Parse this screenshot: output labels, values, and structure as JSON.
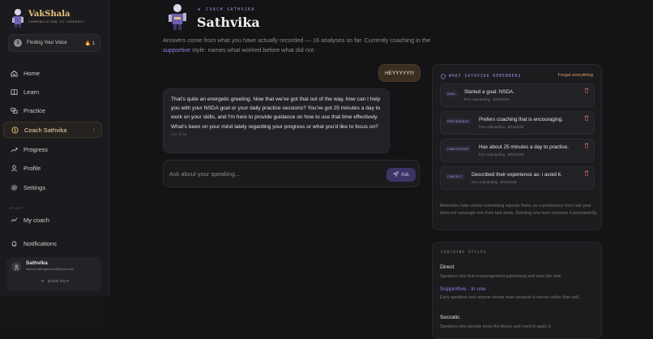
{
  "brand": {
    "name": "VakShala",
    "tagline": "COMMUNICATION IS CURRENCY"
  },
  "level": {
    "badge": "1",
    "label": "Finding Your Voice",
    "streak": "🔥 1"
  },
  "nav": [
    {
      "label": "Home",
      "icon": "home-icon"
    },
    {
      "label": "Learn",
      "icon": "book-icon"
    },
    {
      "label": "Practice",
      "icon": "practice-icon"
    },
    {
      "label": "Coach Sathvika",
      "icon": "coach-icon",
      "active": true
    },
    {
      "label": "Progress",
      "icon": "trend-icon"
    },
    {
      "label": "Profile",
      "icon": "user-icon"
    },
    {
      "label": "Settings",
      "icon": "gear-icon"
    }
  ],
  "staff": {
    "heading": "STAFF",
    "items": [
      {
        "label": "My coach",
        "icon": "coach-link-icon"
      }
    ]
  },
  "notifications": {
    "label": "Notifications"
  },
  "user": {
    "name": "Sathvika",
    "email": "learnachallengemyself@gmail.com",
    "signout": "SIGN OUT"
  },
  "coach": {
    "tag": "COACH SATHVIKA",
    "name": "Sathvika",
    "intro_pre": "Answers come from what you have actually recorded — 16 analyses so far. Currently coaching in the ",
    "intro_style": "supportive",
    "intro_post": " style: names what worked before what did not."
  },
  "chat": {
    "user_message": "HEYYYYY!!!",
    "coach_message": "That's quite an energetic greeting. Now that we've got that out of the way, how can I help you with your NSDA goal or your daily practice sessions? You've got 25 minutes a day to work on your skills, and I'm here to provide guidance on how to use that time effectively. What's been on your mind lately regarding your progress or what you'd like to focus on?",
    "via": "via Groq",
    "input_placeholder": "Ask about your speaking...",
    "ask_label": "Ask"
  },
  "memory": {
    "title": "WHAT SATHVIKA REMEMBERS",
    "forget": "Forget everything",
    "items": [
      {
        "kind": "GOAL",
        "text": "Started a goal: NSDA.",
        "source": "from onboarding · 8/15/2026"
      },
      {
        "kind": "PREFERENCE",
        "text": "Prefers coaching that is encouraging.",
        "source": "from onboarding · 8/15/2026"
      },
      {
        "kind": "CONSTRAINT",
        "text": "Has about 25 minutes a day to practise.",
        "source": "from onboarding · 8/15/2026"
      },
      {
        "kind": "CONTEXT",
        "text": "Described their experience as: i avoid it.",
        "source": "from onboarding · 8/15/2026"
      }
    ],
    "note": "Memories fade unless something repeats them, so a preference from last year does not outweigh one from last week. Deleting one here removes it permanently."
  },
  "styles": {
    "title": "COACHING STYLES",
    "items": [
      {
        "name": "Direct",
        "desc": "Speakers who find encouragement patronising and want the note."
      },
      {
        "name": "Supportive · in use",
        "desc": "Early speakers and anyone whose main obstacle is nerves rather than skill.",
        "active": true
      },
      {
        "name": "Socratic",
        "desc": "Speakers who already know the theory and need to apply it."
      }
    ]
  },
  "colors": {
    "accent": "#8d83e6",
    "brand": "#e8c27a",
    "danger": "#e29a6a",
    "bg": "#141416"
  }
}
